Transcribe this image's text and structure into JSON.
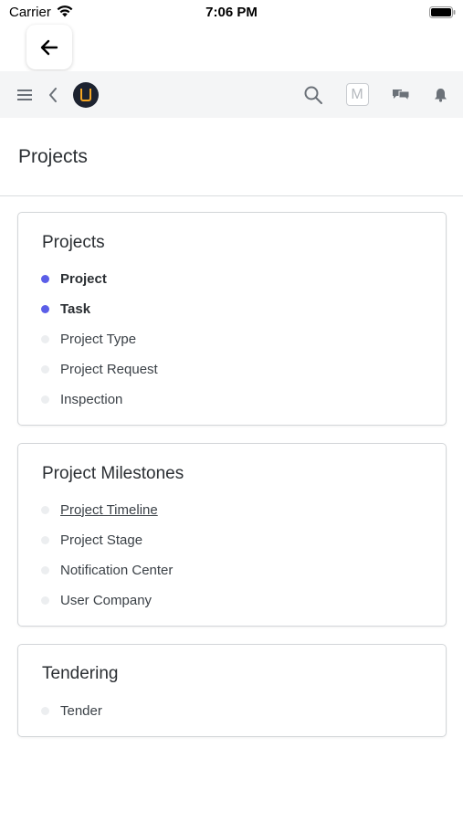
{
  "status_bar": {
    "carrier": "Carrier",
    "time": "7:06 PM"
  },
  "navbar": {
    "avatar_initial": "M",
    "icons": [
      "hamburger-icon",
      "chevron-left-icon",
      "app-logo",
      "search-icon",
      "avatar",
      "chat-bubbles-icon",
      "bell-icon"
    ]
  },
  "page": {
    "title": "Projects"
  },
  "cards": [
    {
      "title": "Projects",
      "items": [
        {
          "label": "Project",
          "active": true
        },
        {
          "label": "Task",
          "active": true
        },
        {
          "label": "Project Type",
          "active": false
        },
        {
          "label": "Project Request",
          "active": false
        },
        {
          "label": "Inspection",
          "active": false
        }
      ]
    },
    {
      "title": "Project Milestones",
      "items": [
        {
          "label": "Project Timeline",
          "active": false,
          "underlined": true
        },
        {
          "label": "Project Stage",
          "active": false
        },
        {
          "label": "Notification Center",
          "active": false
        },
        {
          "label": "User Company",
          "active": false
        }
      ]
    },
    {
      "title": "Tendering",
      "items": [
        {
          "label": "Tender",
          "active": false
        }
      ]
    }
  ],
  "colors": {
    "accent_dot": "#5b5ee8",
    "inactive_dot": "#eceef0",
    "navbar_bg": "#f4f5f6"
  }
}
